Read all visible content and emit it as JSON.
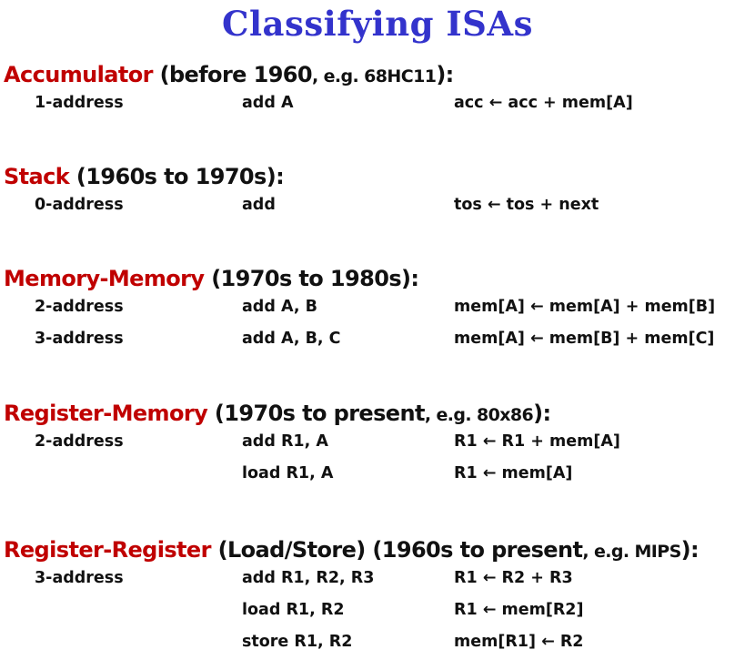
{
  "title": "Classifying ISAs",
  "colors": {
    "title": "#3333cc",
    "accent": "#c00000",
    "text": "#111111"
  },
  "sections": [
    {
      "accent": "Accumulator",
      "text": " (before 1960",
      "eg": ", e.g. 68HC11",
      "tail": "):",
      "rows": [
        {
          "addr": "1-address",
          "instr": "add A",
          "semantics": "acc ←  acc + mem[A]"
        }
      ]
    },
    {
      "accent": "Stack",
      "text": " (1960s to 1970s):",
      "eg": "",
      "tail": "",
      "rows": [
        {
          "addr": "0-address",
          "instr": "add",
          "semantics": "tos ←  tos + next"
        }
      ]
    },
    {
      "accent": "Memory-Memory",
      "text": " (1970s to 1980s):",
      "eg": "",
      "tail": "",
      "rows": [
        {
          "addr": "2-address",
          "instr": "add A, B",
          "semantics": "mem[A] ←  mem[A] + mem[B]"
        },
        {
          "addr": "3-address",
          "instr": "add A, B, C",
          "semantics": "mem[A] ←  mem[B] + mem[C]"
        }
      ]
    },
    {
      "accent": "Register-Memory",
      "text": " (1970s to present",
      "eg": ", e.g. 80x86",
      "tail": "):",
      "rows": [
        {
          "addr": "2-address",
          "instr": "add R1,  A",
          "semantics": "R1 ←  R1 + mem[A]"
        },
        {
          "addr": "",
          "instr": "load R1, A",
          "semantics": "R1 ←  mem[A]"
        }
      ]
    },
    {
      "accent": "Register-Register",
      "text": " (Load/Store) (1960s to present",
      "eg": ", e.g. MIPS",
      "tail": "):",
      "rows": [
        {
          "addr": "3-address",
          "instr": "add R1, R2, R3",
          "semantics": "R1 ←  R2 + R3"
        },
        {
          "addr": "",
          "instr": "load R1, R2",
          "semantics": "R1 ←  mem[R2]"
        },
        {
          "addr": "",
          "instr": "store R1, R2",
          "semantics": "mem[R1] ←  R2"
        }
      ]
    }
  ]
}
